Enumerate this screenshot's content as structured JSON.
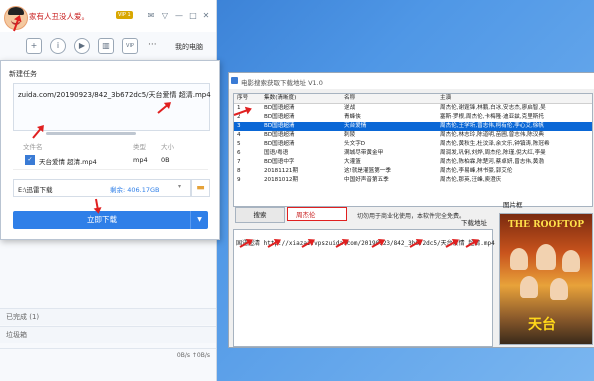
{
  "thunder": {
    "username": "家有人丑没人爱。",
    "vip_badge": "VIP 1",
    "my_computer": "我的电脑",
    "toolbar_icons": [
      "plus-icon",
      "info-icon",
      "play-icon",
      "trash-icon",
      "vip-icon",
      "more-icon"
    ],
    "completed": "已完成 (1)",
    "trash": "垃圾箱",
    "speed": "0B/s  ↑0B/s"
  },
  "new_task": {
    "title": "新建任务",
    "url": "zuida.com/20190923/842_3b672dc5/天台爱情 超清.mp4",
    "col_filename": "文件名",
    "col_type": "类型",
    "col_size": "大小",
    "file_name": "天台爱情 超清.mp4",
    "file_type": "mp4",
    "file_size": "0B",
    "save_path": "E:\\迅雷下载",
    "free_space": "剩余: 406.17GB",
    "download_button": "立即下载"
  },
  "search_app": {
    "window_title": "电影搜索获取下载地址 V1.0",
    "columns": [
      "序号",
      "集数(清晰度)",
      "名称",
      "主演"
    ],
    "rows": [
      [
        "1",
        "BD国语超清",
        "逆战",
        "周杰伦,谢霆锋,林鹏,白冰,安志杰,廖启智,吴"
      ],
      [
        "2",
        "BD国语超清",
        "青蜂侠",
        "塞斯·罗根,周杰伦,卡梅隆·迪亚兹,克里斯托"
      ],
      [
        "3",
        "BD国语超清",
        "天台爱情",
        "周杰伦,王学圻,曾志伟,柯有伦,李心艾,徐帆"
      ],
      [
        "4",
        "BD国语超清",
        "刺陵",
        "周杰伦,林志玲,陈道明,苗圃,曾志伟,陈汉典"
      ],
      [
        "5",
        "BD国语超清",
        "头文字D",
        "周杰伦,黄秋生,杜汶泽,余文乐,钟镇涛,陈冠希"
      ],
      [
        "6",
        "国语/粤语",
        "满城尽带黄金甲",
        "周润发,巩俐,刘烨,周杰伦,陈瑾,倪大红,李曼"
      ],
      [
        "7",
        "BD国语中字",
        "大灌篮",
        "周杰伦,陈柏霖,陈楚河,蔡卓妍,曾志伟,黄渤"
      ],
      [
        "8",
        "20181121期",
        "这!就是灌篮第一季",
        "周杰伦,李易峰,林书豪,郭艾伦"
      ],
      [
        "9",
        "20181012期",
        "中国好声音第五季",
        "周杰伦,那英,汪峰,庾澄庆"
      ]
    ],
    "search_button": "搜索",
    "query": "周杰伦",
    "notice": "切勿用于商业化使用，本软件完全免费。",
    "poster_label": "图片框",
    "link_label": "下载地址",
    "result_text": "国语超清  http://xiazai.vpszuida.com/20190923/842_3b672dc5/天台爱情 超清.mp4",
    "poster_title": "THE ROOFTOP",
    "poster_cn": "天台"
  },
  "colors": {
    "accent": "#2f7fe8",
    "selection": "#0a67d6",
    "annotation": "#e02020",
    "username": "#c81e1e"
  }
}
